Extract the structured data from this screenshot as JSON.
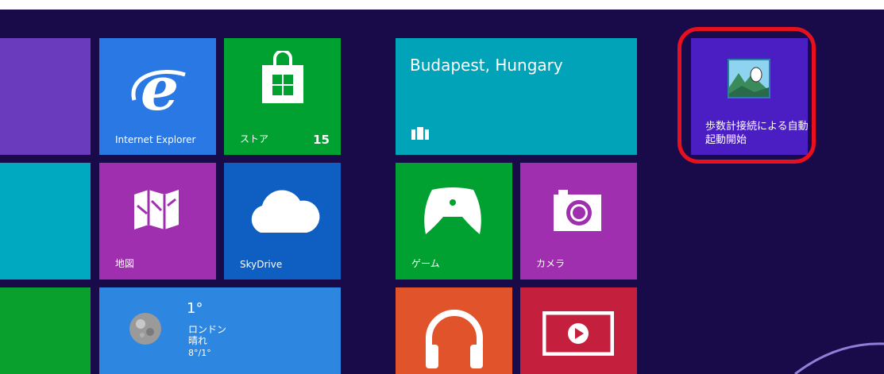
{
  "colors": {
    "background": "#190a4a",
    "highlight_ring": "#e8101f"
  },
  "tiles": {
    "internet_explorer": {
      "label": "Internet Explorer",
      "icon": "ie-icon"
    },
    "store": {
      "label": "ストア",
      "badge": "15",
      "icon": "store-bag-icon"
    },
    "weather_city": {
      "title": "Budapest, Hungary",
      "icon": "briefcase-icon"
    },
    "custom_app": {
      "label": "歩数計接続による自動起動開始",
      "icon": "app-thumbnail-icon"
    },
    "maps": {
      "label": "地図",
      "icon": "map-icon"
    },
    "skydrive": {
      "label": "SkyDrive",
      "icon": "cloud-icon"
    },
    "games": {
      "label": "ゲーム",
      "icon": "game-controller-icon"
    },
    "camera": {
      "label": "カメラ",
      "icon": "camera-icon"
    },
    "weather": {
      "temp": "1°",
      "city": "ロンドン",
      "condition": "晴れ",
      "range": "8°/1°",
      "icon": "moon-icon"
    },
    "music": {
      "icon": "headphones-icon"
    },
    "video": {
      "icon": "play-icon"
    }
  }
}
